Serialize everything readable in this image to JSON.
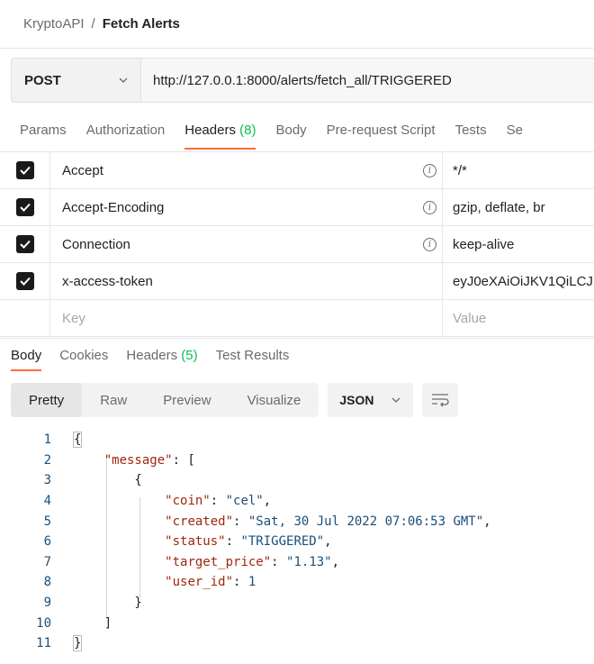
{
  "breadcrumb": {
    "collection": "KryptoAPI",
    "separator": "/",
    "request": "Fetch Alerts"
  },
  "request": {
    "method": "POST",
    "url": "http://127.0.0.1:8000/alerts/fetch_all/TRIGGERED"
  },
  "request_tabs": [
    {
      "label": "Params"
    },
    {
      "label": "Authorization"
    },
    {
      "label": "Headers",
      "count": "(8)",
      "active": true
    },
    {
      "label": "Body"
    },
    {
      "label": "Pre-request Script"
    },
    {
      "label": "Tests"
    },
    {
      "label": "Se"
    }
  ],
  "headers": [
    {
      "key": "Accept",
      "value": "*/*"
    },
    {
      "key": "Accept-Encoding",
      "value": "gzip, deflate, br"
    },
    {
      "key": "Connection",
      "value": "keep-alive"
    },
    {
      "key": "x-access-token",
      "value": "eyJ0eXAiOiJKV1QiLCJ"
    }
  ],
  "headers_placeholder": {
    "key": "Key",
    "value": "Value"
  },
  "response_tabs": [
    {
      "label": "Body",
      "active": true
    },
    {
      "label": "Cookies"
    },
    {
      "label": "Headers",
      "count": "(5)"
    },
    {
      "label": "Test Results"
    }
  ],
  "view_modes": [
    "Pretty",
    "Raw",
    "Preview",
    "Visualize"
  ],
  "active_view": "Pretty",
  "language": "JSON",
  "code_lines": [
    "1",
    "2",
    "3",
    "4",
    "5",
    "6",
    "7",
    "8",
    "9",
    "10",
    "11"
  ],
  "response": {
    "key_message": "\"message\"",
    "key_coin": "\"coin\"",
    "val_coin": "\"cel\"",
    "key_created": "\"created\"",
    "val_created": "\"Sat, 30 Jul 2022 07:06:53 GMT\"",
    "key_status": "\"status\"",
    "val_status": "\"TRIGGERED\"",
    "key_target_price": "\"target_price\"",
    "val_target_price": "\"1.13\"",
    "key_user_id": "\"user_id\"",
    "val_user_id": "1"
  },
  "colors": {
    "accent": "#ff6c37",
    "count": "#0cbb52",
    "json_key": "#a1260d",
    "json_value": "#1a4f7a"
  }
}
